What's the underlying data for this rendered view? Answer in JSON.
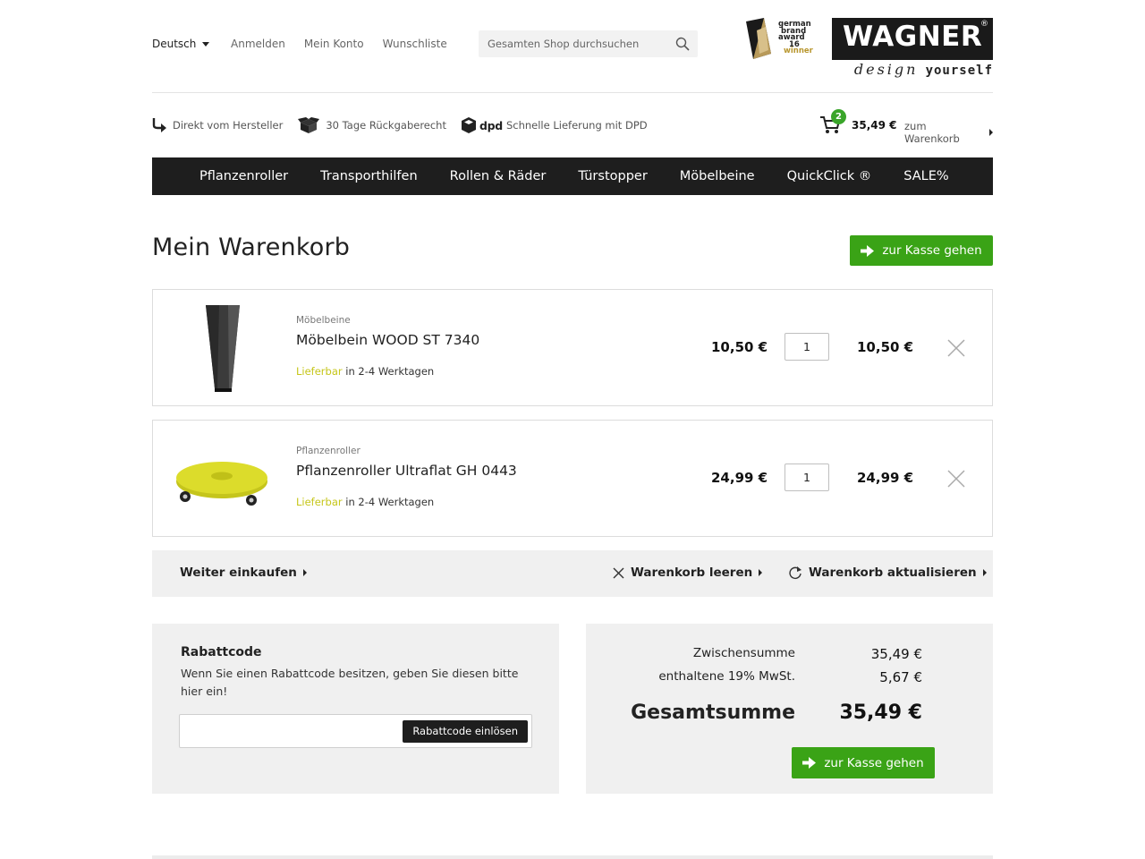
{
  "header": {
    "language": "Deutsch",
    "links": [
      "Anmelden",
      "Mein Konto",
      "Wunschliste"
    ],
    "search_placeholder": "Gesamten Shop durchsuchen",
    "award_text": [
      "german",
      "brand",
      "award",
      "16",
      "winner"
    ],
    "logo_text": "WAGNER",
    "logo_reg": "®",
    "logo_tagline_a": "design",
    "logo_tagline_b": "yourself"
  },
  "usps": [
    "Direkt vom Hersteller",
    "30 Tage Rückgaberecht",
    "Schnelle Lieferung mit DPD"
  ],
  "usp_dpd_logo": "dpd",
  "minicart": {
    "count": "2",
    "total": "35,49 €",
    "link": "zum Warenkorb"
  },
  "nav": [
    "Pflanzenroller",
    "Transporthilfen",
    "Rollen & Räder",
    "Türstopper",
    "Möbelbeine",
    "QuickClick ®",
    "SALE%"
  ],
  "page": {
    "title": "Mein Warenkorb",
    "checkout_label": "zur Kasse gehen"
  },
  "items": [
    {
      "category": "Möbelbeine",
      "name": "Möbelbein WOOD ST 7340",
      "availability": "Lieferbar",
      "delivery": "in 2-4 Werktagen",
      "unit_price": "10,50 €",
      "qty": "1",
      "row_total": "10,50 €"
    },
    {
      "category": "Pflanzenroller",
      "name": "Pflanzenroller Ultraflat GH 0443",
      "availability": "Lieferbar",
      "delivery": "in 2-4 Werktagen",
      "unit_price": "24,99 €",
      "qty": "1",
      "row_total": "24,99 €"
    }
  ],
  "actions": {
    "continue": "Weiter einkaufen",
    "clear": "Warenkorb leeren",
    "update": "Warenkorb aktualisieren"
  },
  "coupon": {
    "title": "Rabattcode",
    "description": "Wenn Sie einen Rabattcode besitzen, geben Sie diesen bitte hier ein!",
    "input_value": "",
    "button": "Rabattcode einlösen"
  },
  "totals": {
    "subtotal_label": "Zwischensumme",
    "subtotal": "35,49 €",
    "tax_label": "enthaltene 19% MwSt.",
    "tax": "5,67 €",
    "grand_label": "Gesamtsumme",
    "grand": "35,49 €"
  },
  "colors": {
    "accent_green": "#3aa316",
    "nav_bg": "#1e1e1e",
    "availability": "#c6c619",
    "panel_bg": "#f0f0f0"
  }
}
